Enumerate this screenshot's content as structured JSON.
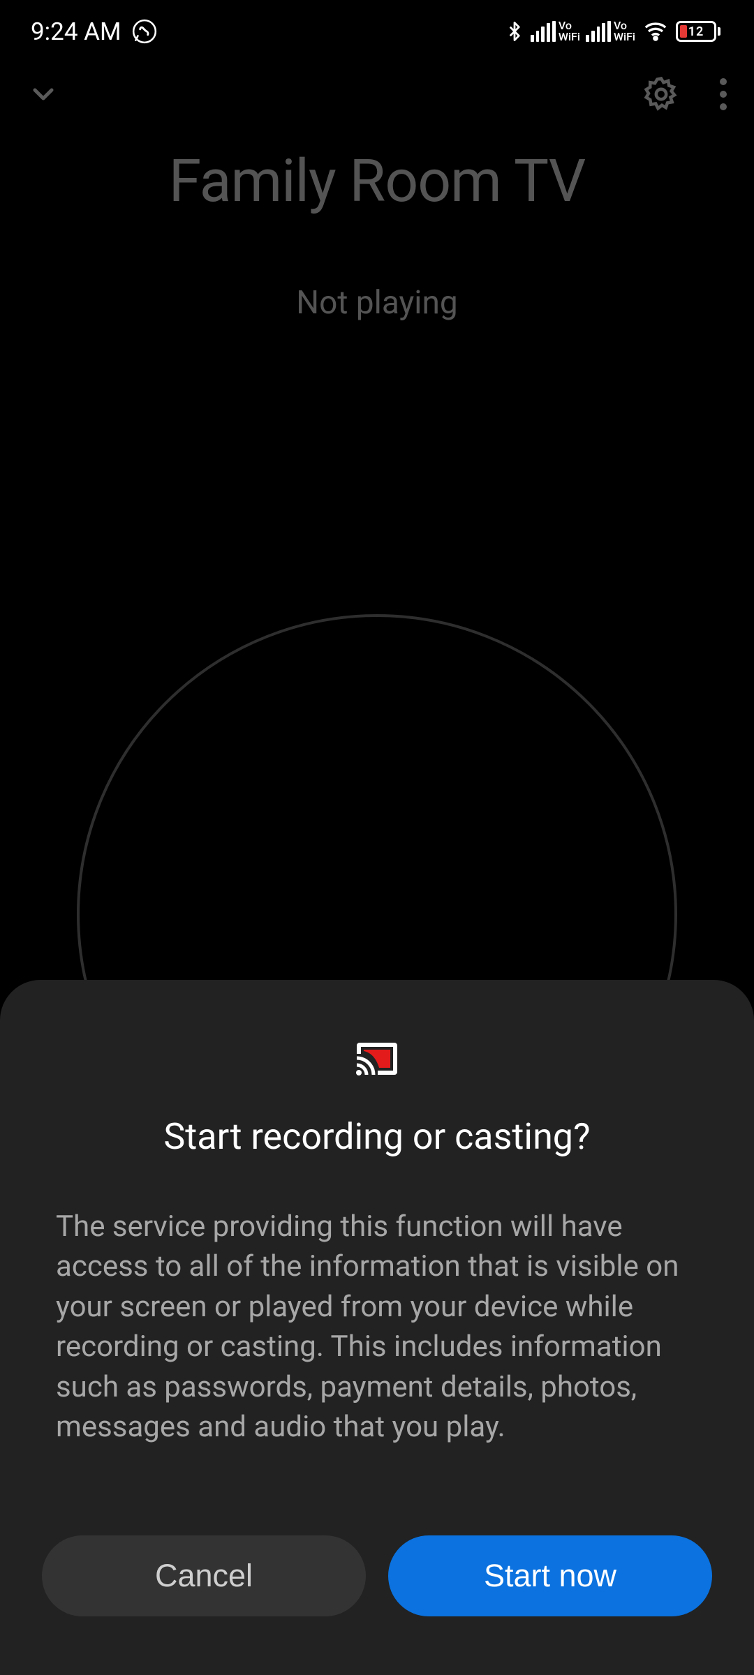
{
  "statusBar": {
    "time": "9:24 AM",
    "batteryLevel": "12"
  },
  "main": {
    "deviceTitle": "Family Room TV",
    "playbackStatus": "Not playing"
  },
  "dialog": {
    "title": "Start recording or casting?",
    "body": "The service providing this function will have access to all of the information that is visible on your screen or played from your device while recording or casting. This includes information such as passwords, payment details, photos, messages and audio that you play.",
    "cancel": "Cancel",
    "confirm": "Start now"
  }
}
